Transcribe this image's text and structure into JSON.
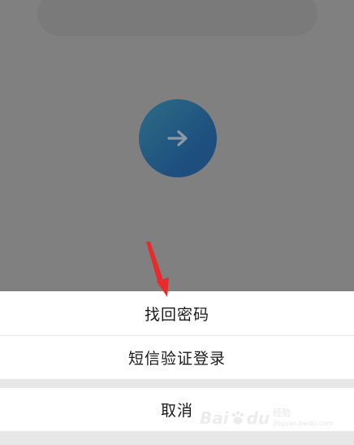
{
  "action_sheet": {
    "find_password_label": "找回密码",
    "sms_login_label": "短信验证登录",
    "cancel_label": "取消"
  },
  "login_button": {
    "icon": "arrow-right-icon",
    "gradient_start": "#2c6c86",
    "gradient_end": "#1c4c7d"
  },
  "overlay_color": "#808080",
  "annotation": {
    "color": "#e82a2a",
    "icon": "red-arrow-annotation"
  },
  "watermark": {
    "brand_left": "Bai",
    "brand_right": "du",
    "sub_top": "经验",
    "sub_bottom": "jingyan.baidu.com"
  }
}
